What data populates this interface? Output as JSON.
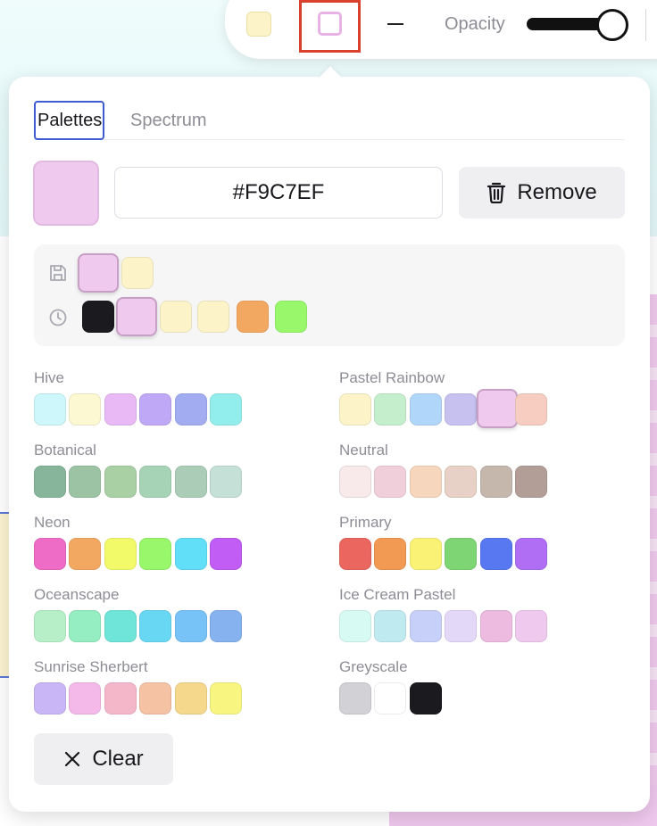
{
  "toolbar": {
    "fill_color": "#FCF4C8",
    "stroke_color": "#F9C7EF",
    "opacity_label": "Opacity",
    "opacity_value": 1.0
  },
  "picker": {
    "tabs": [
      {
        "label": "Palettes",
        "active": true
      },
      {
        "label": "Spectrum",
        "active": false
      }
    ],
    "current_color": "#F9C7EF",
    "hex_value": "#F9C7EF",
    "remove_label": "Remove",
    "clear_label": "Clear",
    "saved_icon": "save-icon",
    "recent_icon": "clock-icon",
    "saved_colors": [
      "#F0C9EE",
      "#FCF4C8"
    ],
    "recent_colors": [
      "#1B1B1F",
      "#F0C9EE",
      "#FCF4C8",
      "#FCF4C8",
      "#F3A862",
      "#98F76A"
    ],
    "palettes": [
      {
        "name": "Hive",
        "colors": [
          "#CDF7FA",
          "#FCF8D2",
          "#E9B9F6",
          "#BFA8F5",
          "#A2ACF1",
          "#92EEEC"
        ]
      },
      {
        "name": "Pastel Rainbow",
        "colors": [
          "#FCF4C8",
          "#C4EECC",
          "#B0D6FA",
          "#C7C1F0",
          "#F0C9EE",
          "#F6CDC0"
        ]
      },
      {
        "name": "Botanical",
        "colors": [
          "#87B59B",
          "#9CC3A4",
          "#A8D0A4",
          "#A6D3B6",
          "#ABCDB7",
          "#C5E0D6"
        ]
      },
      {
        "name": "Neutral",
        "colors": [
          "#F8E9EA",
          "#F0CFDB",
          "#F6D6BD",
          "#E7D0C6",
          "#C6B7AD",
          "#B29E96"
        ]
      },
      {
        "name": "Neon",
        "colors": [
          "#EE6BC6",
          "#F3A862",
          "#F2FA6A",
          "#98F76A",
          "#61DFF8",
          "#C15DF4"
        ]
      },
      {
        "name": "Primary",
        "colors": [
          "#EC6660",
          "#F29A54",
          "#FAF275",
          "#7DD574",
          "#5878F2",
          "#AF6EF3"
        ]
      },
      {
        "name": "Oceanscape",
        "colors": [
          "#B6EFC8",
          "#94EEC1",
          "#6EE5D8",
          "#68D7F4",
          "#77C2F6",
          "#86B2EF"
        ]
      },
      {
        "name": "Ice Cream Pastel",
        "colors": [
          "#D7FAF3",
          "#BFEBF0",
          "#C7D0F8",
          "#E4D8F8",
          "#EDBAE0",
          "#F0C9EE"
        ]
      },
      {
        "name": "Sunrise Sherbert",
        "colors": [
          "#C9B6F6",
          "#F5B9E9",
          "#F4B7C9",
          "#F5C2A4",
          "#F6D88C",
          "#F8F680"
        ]
      },
      {
        "name": "Greyscale",
        "colors": [
          "#D2D2D6",
          "#FFFFFF",
          "#1B1B1F"
        ]
      }
    ]
  }
}
